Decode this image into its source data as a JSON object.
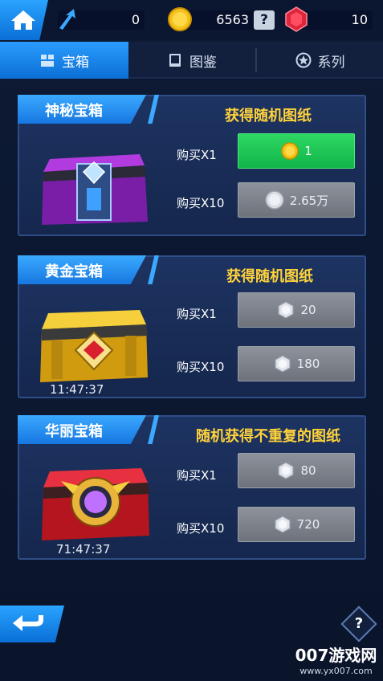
{
  "topbar": {
    "upgrade_value": "0",
    "coins_value": "6563",
    "help_label": "?",
    "gems_value": "10"
  },
  "tabs": [
    {
      "label": "宝箱",
      "icon": "box-icon",
      "active": true
    },
    {
      "label": "图鉴",
      "icon": "book-icon",
      "active": false
    },
    {
      "label": "系列",
      "icon": "star-icon",
      "active": false
    }
  ],
  "cards": [
    {
      "title": "神秘宝箱",
      "subtitle": "获得随机图纸",
      "chest": "mystery-chest",
      "timer": "",
      "buy1_label": "购买X1",
      "buy1_price": "1",
      "buy1_currency": "coin-icon",
      "buy10_label": "购买X10",
      "buy10_price": "2.65万",
      "buy10_currency": "silver-coin-icon"
    },
    {
      "title": "黄金宝箱",
      "subtitle": "获得随机图纸",
      "chest": "gold-chest",
      "timer": "11:47:37",
      "buy1_label": "购买X1",
      "buy1_price": "20",
      "buy1_currency": "diamond-icon",
      "buy10_label": "购买X10",
      "buy10_price": "180",
      "buy10_currency": "diamond-icon"
    },
    {
      "title": "华丽宝箱",
      "subtitle": "随机获得不重复的图纸",
      "chest": "gorgeous-chest",
      "timer": "71:47:37",
      "buy1_label": "购买X1",
      "buy1_price": "80",
      "buy1_currency": "diamond-icon",
      "buy10_label": "购买X10",
      "buy10_price": "720",
      "buy10_currency": "diamond-icon"
    }
  ],
  "bottom": {
    "help_label": "?"
  },
  "watermark": {
    "title": "007游戏网",
    "url": "www.yx007.com"
  },
  "colors": {
    "accent": "#1a86f0",
    "green_button": "#1ec454",
    "subtitle_yellow": "#ffd23a",
    "card_bg": "#1a2e58"
  }
}
